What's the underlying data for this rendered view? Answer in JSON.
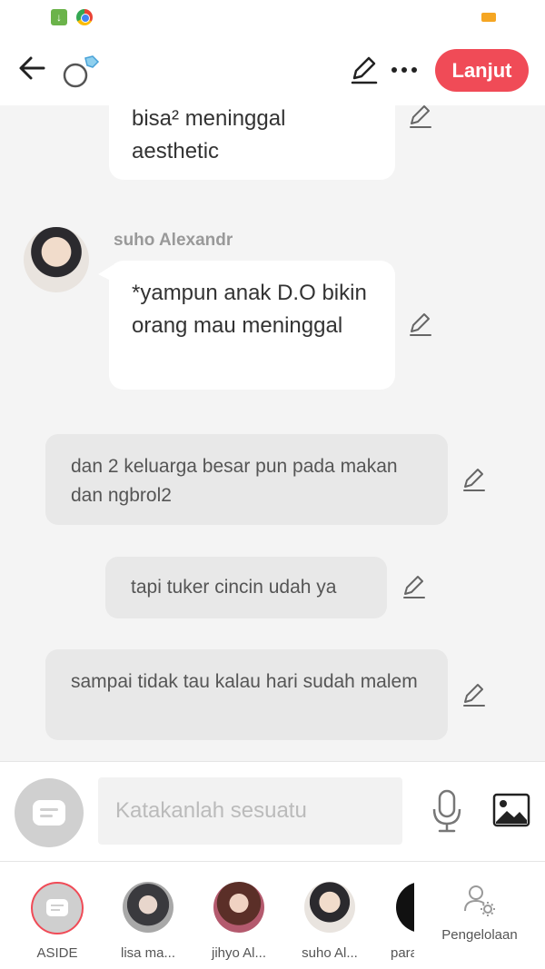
{
  "header": {
    "next_label": "Lanjut"
  },
  "messages": [
    {
      "type": "bubble",
      "text": "bisa² meninggal aesthetic"
    },
    {
      "type": "bubble",
      "sender": "suho Alexandr",
      "text": "*yampun anak D.O bikin orang mau meninggal"
    },
    {
      "type": "narration",
      "text": "dan 2 keluarga besar pun pada makan dan ngbrol2"
    },
    {
      "type": "narration",
      "text": "tapi tuker cincin udah ya"
    },
    {
      "type": "narration",
      "text": "sampai tidak tau kalau hari sudah malem"
    }
  ],
  "input": {
    "placeholder": "Katakanlah sesuatu"
  },
  "characters": [
    {
      "name": "ASIDE"
    },
    {
      "name": "lisa ma..."
    },
    {
      "name": "jihyo Al..."
    },
    {
      "name": "suho Al..."
    },
    {
      "name": "para"
    }
  ],
  "manage_label": "Pengelolaan",
  "colors": {
    "accent": "#f04b57",
    "bubble": "#ffffff",
    "narration": "#e8e8e8"
  }
}
